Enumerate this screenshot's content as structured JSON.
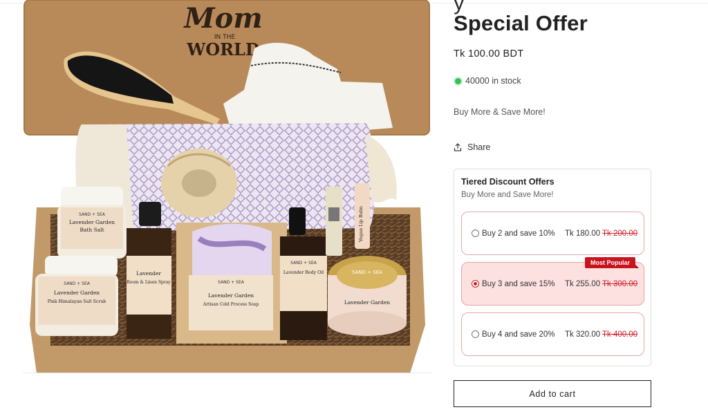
{
  "product": {
    "title_line_clipped": "y",
    "title": "Special Offer",
    "price": "Tk 100.00 BDT",
    "stock": "40000 in stock",
    "promo_text": "Buy More & Save More!",
    "share_label": "Share",
    "image_text": {
      "lid_logo_top": "Mom",
      "lid_logo_mid": "IN THE",
      "lid_logo_bottom": "WORLD",
      "jar1_brand": "SAND + SEA",
      "jar1_name": "Lavender Garden",
      "jar1_type": "Bath Salt",
      "jar2_brand": "SAND + SEA",
      "jar2_name": "Lavender Garden",
      "jar2_type": "Pink Himalayan Salt Scrub",
      "spray_name": "Lavender",
      "spray_type": "Room & Linen Spray",
      "soap_brand": "SAND + SEA",
      "soap_name": "Lavender Garden",
      "soap_type": "Artisan Cold Process Soap",
      "oil_brand": "SAND + SEA",
      "oil_name": "Lavender Body Oil",
      "balm_name": "Vegan Lip Balm",
      "candle_brand": "SAND + SEA",
      "candle_name": "Lavender Garden"
    }
  },
  "tiers": {
    "title": "Tiered Discount Offers",
    "subtitle": "Buy More and Save More!",
    "options": [
      {
        "label": "Buy 2 and save 10%",
        "price": "Tk 180.00",
        "old_price": "Tk 200.00",
        "selected": false,
        "badge": ""
      },
      {
        "label": "Buy 3 and save 15%",
        "price": "Tk 255.00",
        "old_price": "Tk 300.00",
        "selected": true,
        "badge": "Most Popular"
      },
      {
        "label": "Buy 4 and save 20%",
        "price": "Tk 320.00",
        "old_price": "Tk 400.00",
        "selected": false,
        "badge": ""
      }
    ]
  },
  "add_to_cart_label": "Add to cart",
  "colors": {
    "accent_red": "#c9141e",
    "selected_bg": "#fde1e1",
    "stock_green": "#37c05a"
  },
  "icons": [
    "share-icon",
    "stock-indicator-icon",
    "radio-icon"
  ]
}
